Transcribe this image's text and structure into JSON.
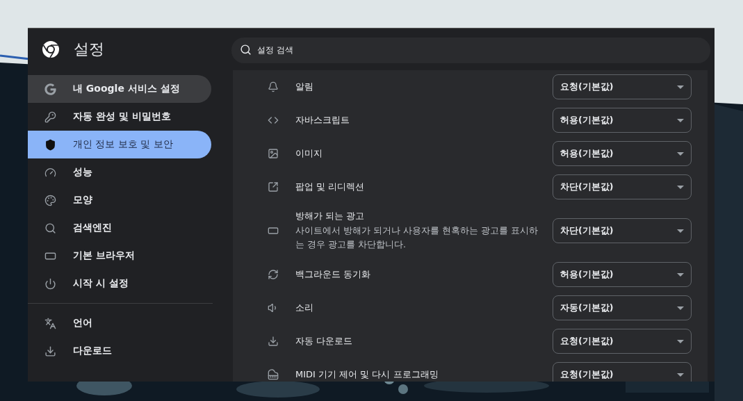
{
  "window": {
    "title": "설정"
  },
  "search": {
    "placeholder": "설정 검색"
  },
  "sidebar": {
    "items": [
      {
        "label": "내 Google 서비스 설정",
        "selected": false,
        "hovered": true
      },
      {
        "label": "자동 완성 및 비밀번호",
        "selected": false,
        "hovered": false
      },
      {
        "label": "개인 정보 보호 및 보안",
        "selected": true,
        "hovered": false
      },
      {
        "label": "성능",
        "selected": false,
        "hovered": false
      },
      {
        "label": "모양",
        "selected": false,
        "hovered": false
      },
      {
        "label": "검색엔진",
        "selected": false,
        "hovered": false
      },
      {
        "label": "기본 브라우저",
        "selected": false,
        "hovered": false
      },
      {
        "label": "시작 시 설정",
        "selected": false,
        "hovered": false
      }
    ],
    "more_items": [
      {
        "label": "언어",
        "selected": false,
        "hovered": false
      },
      {
        "label": "다운로드",
        "selected": false,
        "hovered": false
      }
    ]
  },
  "permissions": [
    {
      "label": "알림",
      "value": "요청(기본값)"
    },
    {
      "label": "자바스크립트",
      "value": "허용(기본값)"
    },
    {
      "label": "이미지",
      "value": "허용(기본값)"
    },
    {
      "label": "팝업 및 리디렉션",
      "value": "차단(기본값)"
    },
    {
      "label": "방해가 되는 광고",
      "description": "사이트에서 방해가 되거나 사용자를 현혹하는 광고를 표시하는 경우 광고를 차단합니다.",
      "value": "차단(기본값)"
    },
    {
      "label": "백그라운드 동기화",
      "value": "허용(기본값)"
    },
    {
      "label": "소리",
      "value": "자동(기본값)"
    },
    {
      "label": "자동 다운로드",
      "value": "요청(기본값)"
    },
    {
      "label": "MIDI 기기 제어 및 다시 프로그래밍",
      "value": "요청(기본값)"
    }
  ]
}
